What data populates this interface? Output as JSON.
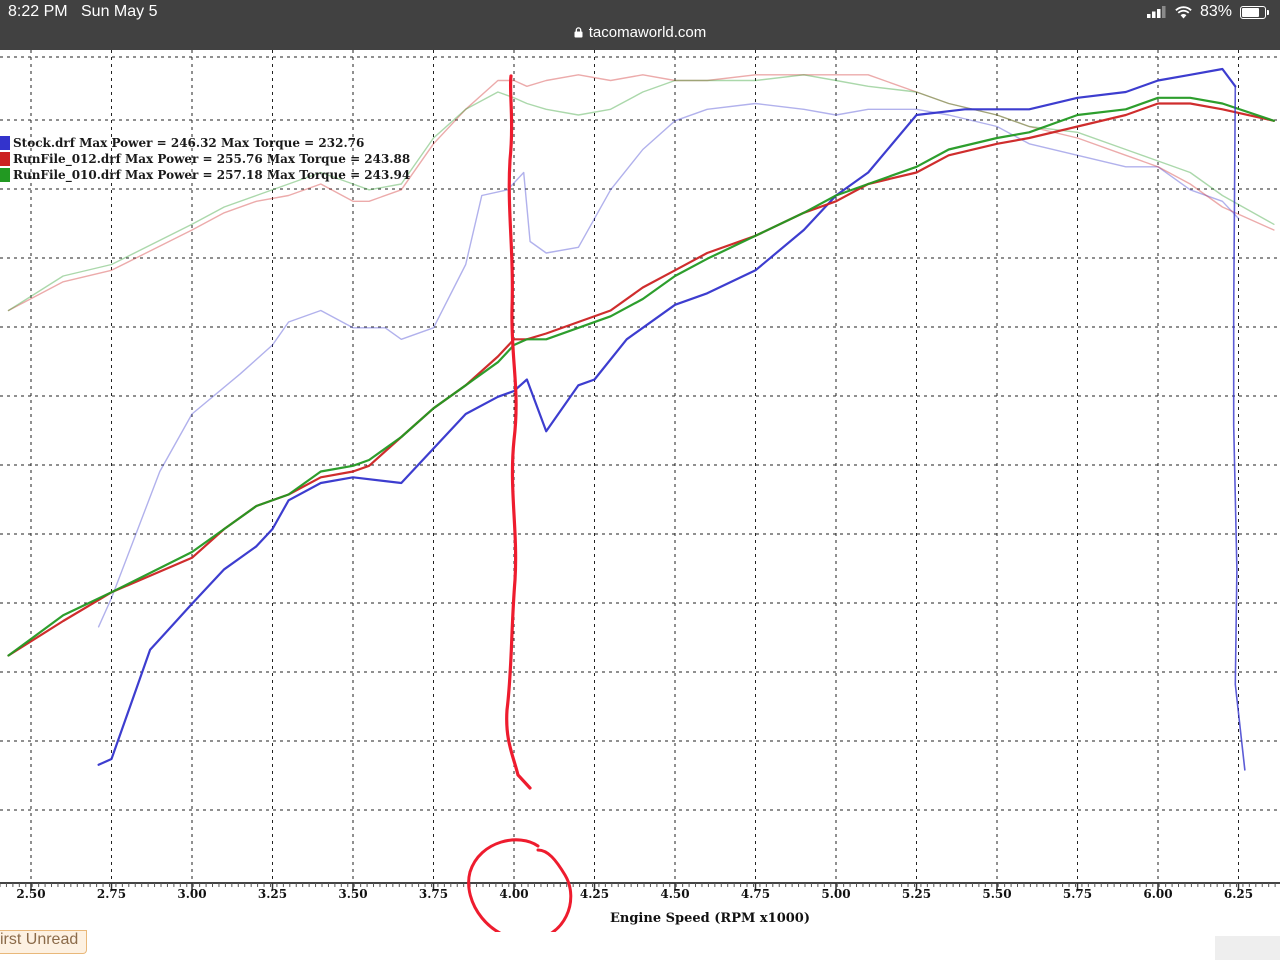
{
  "status_bar": {
    "time": "8:22 PM",
    "date": "Sun May 5",
    "url": "tacomaworld.com",
    "battery": "83%",
    "battery_level": 0.83
  },
  "page": {
    "first_unread_label": "irst Unread"
  },
  "colors": {
    "stock": "#3333cc",
    "runfile_012": "#cc2222",
    "runfile_010": "#229922",
    "annotation": "#ee1c2e",
    "grid": "#222222"
  },
  "chart_data": {
    "type": "line",
    "title": "",
    "xlabel": "Engine Speed (RPM x1000)",
    "ylabel": "",
    "xlim": [
      2.43,
      6.36
    ],
    "ylim": [
      0,
      1
    ],
    "x_ticks": [
      2.5,
      2.75,
      3.0,
      3.25,
      3.5,
      3.75,
      4.0,
      4.25,
      4.5,
      4.75,
      5.0,
      5.25,
      5.5,
      5.75,
      6.0,
      6.25
    ],
    "x_tick_labels": [
      "2.50",
      "2.75",
      "3.00",
      "3.25",
      "3.50",
      "3.75",
      "4.00",
      "4.25",
      "4.50",
      "4.75",
      "5.00",
      "5.25",
      "5.50",
      "5.75",
      "6.00",
      "6.25"
    ],
    "grid": true,
    "legend": {
      "position": "top-left",
      "entries": [
        {
          "label": "Stock.drf Max Power = 246.32 Max Torque = 232.76",
          "color": "#3333cc"
        },
        {
          "label": "RunFile_012.drf Max Power = 255.76 Max Torque = 243.88",
          "color": "#cc2222"
        },
        {
          "label": "RunFile_010.drf Max Power = 257.18 Max Torque = 243.94",
          "color": "#229922"
        }
      ]
    },
    "series": [
      {
        "key": "stock_power",
        "name": "Stock.drf",
        "measure": "power",
        "color": "#3333cc",
        "faint": false,
        "x": [
          2.71,
          2.75,
          2.87,
          3.0,
          3.1,
          3.2,
          3.25,
          3.3,
          3.4,
          3.5,
          3.65,
          3.75,
          3.85,
          3.95,
          4.0,
          4.04,
          4.1,
          4.2,
          4.25,
          4.35,
          4.5,
          4.6,
          4.75,
          4.9,
          5.0,
          5.1,
          5.25,
          5.4,
          5.5,
          5.6,
          5.75,
          5.9,
          6.0,
          6.1,
          6.2,
          6.24
        ],
        "y": [
          0.11,
          0.12,
          0.31,
          0.39,
          0.45,
          0.49,
          0.52,
          0.57,
          0.6,
          0.61,
          0.6,
          0.66,
          0.72,
          0.75,
          0.76,
          0.78,
          0.69,
          0.77,
          0.78,
          0.85,
          0.91,
          0.93,
          0.97,
          1.04,
          1.1,
          1.14,
          1.24,
          1.25,
          1.25,
          1.25,
          1.27,
          1.28,
          1.3,
          1.31,
          1.32,
          1.29
        ]
      },
      {
        "key": "runfile012_power",
        "name": "RunFile_012.drf",
        "measure": "power",
        "color": "#cc2222",
        "faint": false,
        "x": [
          2.43,
          2.6,
          2.75,
          3.0,
          3.1,
          3.2,
          3.3,
          3.4,
          3.5,
          3.55,
          3.65,
          3.75,
          3.85,
          3.95,
          4.0,
          4.04,
          4.1,
          4.2,
          4.3,
          4.4,
          4.5,
          4.6,
          4.75,
          4.9,
          5.0,
          5.1,
          5.25,
          5.35,
          5.5,
          5.6,
          5.75,
          5.9,
          6.0,
          6.1,
          6.2,
          6.36
        ],
        "y": [
          0.3,
          0.36,
          0.41,
          0.47,
          0.52,
          0.56,
          0.58,
          0.61,
          0.62,
          0.63,
          0.68,
          0.73,
          0.77,
          0.82,
          0.85,
          0.85,
          0.86,
          0.88,
          0.9,
          0.94,
          0.97,
          1.0,
          1.03,
          1.07,
          1.09,
          1.12,
          1.14,
          1.17,
          1.19,
          1.2,
          1.22,
          1.24,
          1.26,
          1.26,
          1.25,
          1.23
        ]
      },
      {
        "key": "runfile010_power",
        "name": "RunFile_010.drf",
        "measure": "power",
        "color": "#229922",
        "faint": false,
        "x": [
          2.43,
          2.6,
          2.75,
          3.0,
          3.1,
          3.2,
          3.3,
          3.4,
          3.5,
          3.55,
          3.65,
          3.75,
          3.85,
          3.95,
          4.0,
          4.04,
          4.1,
          4.2,
          4.3,
          4.4,
          4.5,
          4.6,
          4.75,
          4.9,
          5.0,
          5.1,
          5.25,
          5.35,
          5.5,
          5.6,
          5.75,
          5.9,
          6.0,
          6.1,
          6.2,
          6.36
        ],
        "y": [
          0.3,
          0.37,
          0.41,
          0.48,
          0.52,
          0.56,
          0.58,
          0.62,
          0.63,
          0.64,
          0.68,
          0.73,
          0.77,
          0.81,
          0.84,
          0.85,
          0.85,
          0.87,
          0.89,
          0.92,
          0.96,
          0.99,
          1.03,
          1.07,
          1.1,
          1.12,
          1.15,
          1.18,
          1.2,
          1.21,
          1.24,
          1.25,
          1.27,
          1.27,
          1.26,
          1.23
        ]
      },
      {
        "key": "stock_torque",
        "name": "Stock.drf",
        "measure": "torque",
        "color": "#3333cc",
        "faint": true,
        "x": [
          2.71,
          2.75,
          2.9,
          3.0,
          3.15,
          3.25,
          3.3,
          3.4,
          3.5,
          3.6,
          3.65,
          3.75,
          3.85,
          3.9,
          3.98,
          4.03,
          4.05,
          4.1,
          4.2,
          4.3,
          4.4,
          4.5,
          4.6,
          4.75,
          4.9,
          5.0,
          5.1,
          5.25,
          5.35,
          5.5,
          5.6,
          5.75,
          5.9,
          6.0,
          6.1,
          6.2,
          6.25
        ],
        "y": [
          0.35,
          0.4,
          0.62,
          0.72,
          0.79,
          0.84,
          0.88,
          0.9,
          0.87,
          0.87,
          0.85,
          0.87,
          0.98,
          1.1,
          1.11,
          1.14,
          1.02,
          1.0,
          1.01,
          1.11,
          1.18,
          1.23,
          1.25,
          1.26,
          1.25,
          1.24,
          1.25,
          1.25,
          1.24,
          1.22,
          1.19,
          1.17,
          1.15,
          1.15,
          1.11,
          1.09,
          1.06
        ]
      },
      {
        "key": "runfile012_torque",
        "name": "RunFile_012.drf",
        "measure": "torque",
        "color": "#cc2222",
        "faint": true,
        "x": [
          2.43,
          2.6,
          2.75,
          3.0,
          3.1,
          3.2,
          3.3,
          3.4,
          3.5,
          3.55,
          3.65,
          3.75,
          3.85,
          3.95,
          4.0,
          4.04,
          4.1,
          4.2,
          4.3,
          4.4,
          4.5,
          4.6,
          4.75,
          4.9,
          5.0,
          5.1,
          5.25,
          5.35,
          5.5,
          5.6,
          5.75,
          5.9,
          6.0,
          6.1,
          6.2,
          6.36
        ],
        "y": [
          0.9,
          0.95,
          0.97,
          1.04,
          1.07,
          1.09,
          1.1,
          1.12,
          1.09,
          1.09,
          1.11,
          1.19,
          1.25,
          1.3,
          1.3,
          1.29,
          1.3,
          1.31,
          1.3,
          1.31,
          1.3,
          1.3,
          1.31,
          1.31,
          1.31,
          1.31,
          1.28,
          1.26,
          1.24,
          1.22,
          1.2,
          1.17,
          1.15,
          1.12,
          1.08,
          1.04
        ]
      },
      {
        "key": "runfile010_torque",
        "name": "RunFile_010.drf",
        "measure": "torque",
        "color": "#229922",
        "faint": true,
        "x": [
          2.43,
          2.6,
          2.75,
          3.0,
          3.1,
          3.2,
          3.3,
          3.4,
          3.5,
          3.55,
          3.65,
          3.75,
          3.85,
          3.95,
          4.0,
          4.04,
          4.1,
          4.2,
          4.3,
          4.4,
          4.5,
          4.6,
          4.75,
          4.9,
          5.0,
          5.1,
          5.25,
          5.35,
          5.5,
          5.6,
          5.75,
          5.9,
          6.0,
          6.1,
          6.2,
          6.36
        ],
        "y": [
          0.9,
          0.96,
          0.98,
          1.05,
          1.08,
          1.1,
          1.12,
          1.14,
          1.12,
          1.11,
          1.12,
          1.2,
          1.25,
          1.28,
          1.27,
          1.26,
          1.25,
          1.24,
          1.25,
          1.28,
          1.3,
          1.3,
          1.3,
          1.31,
          1.3,
          1.29,
          1.28,
          1.26,
          1.24,
          1.22,
          1.21,
          1.18,
          1.16,
          1.14,
          1.1,
          1.05
        ]
      }
    ]
  }
}
